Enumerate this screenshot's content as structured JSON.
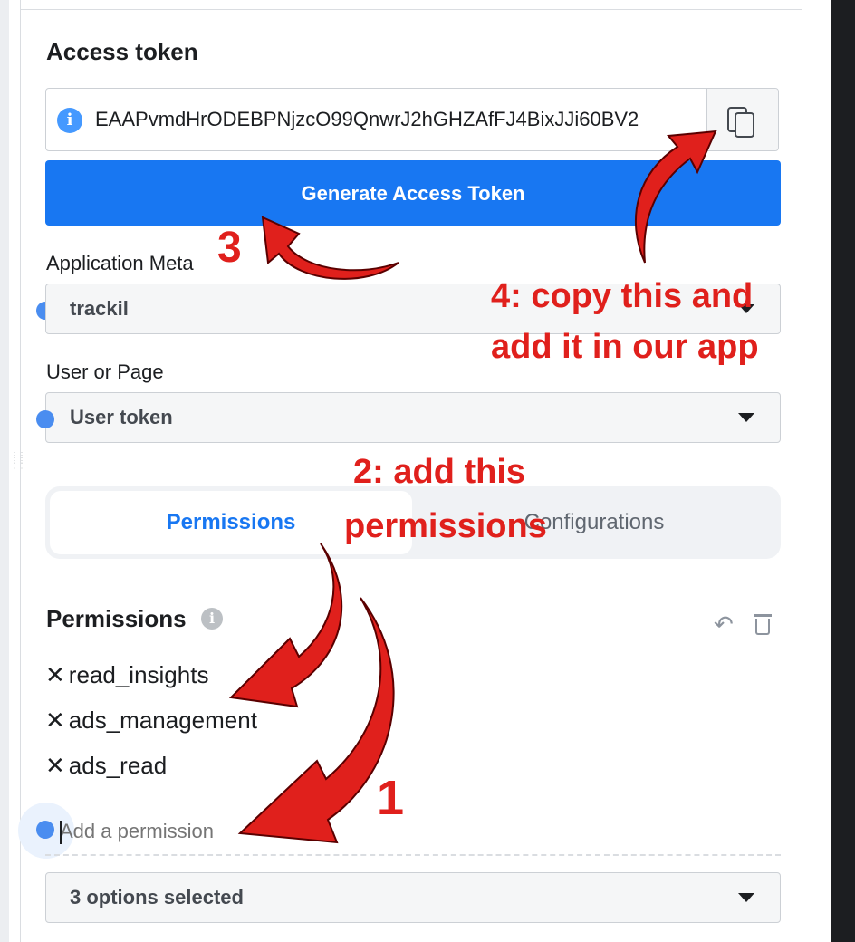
{
  "access_token": {
    "title": "Access token",
    "value": "EAAPvmdHrODEBPNjzcO99QnwrJ2hGHZAfFJ4BixJJi60BV2",
    "info_icon": "info-icon",
    "copy_icon": "copy-icon"
  },
  "generate_button": "Generate Access Token",
  "application": {
    "label": "Application Meta",
    "selected": "trackil"
  },
  "user_or_page": {
    "label": "User or Page",
    "selected": "User token"
  },
  "tabs": [
    {
      "label": "Permissions",
      "active": true
    },
    {
      "label": "Configurations",
      "active": false
    }
  ],
  "permissions": {
    "title": "Permissions",
    "items": [
      "read_insights",
      "ads_management",
      "ads_read"
    ],
    "placeholder": "Add a permission",
    "options_summary": "3 options selected",
    "remove_glyph": "✕"
  },
  "annotations": {
    "step1": "1",
    "step2_line1": "2: add this",
    "step2_line2": "permissions",
    "step3": "3",
    "step4_line1": "4: copy this  and",
    "step4_line2": "add it in our app"
  },
  "colors": {
    "primary": "#1877f2",
    "annotation": "#e0201c",
    "dot": "#4a8df0"
  }
}
